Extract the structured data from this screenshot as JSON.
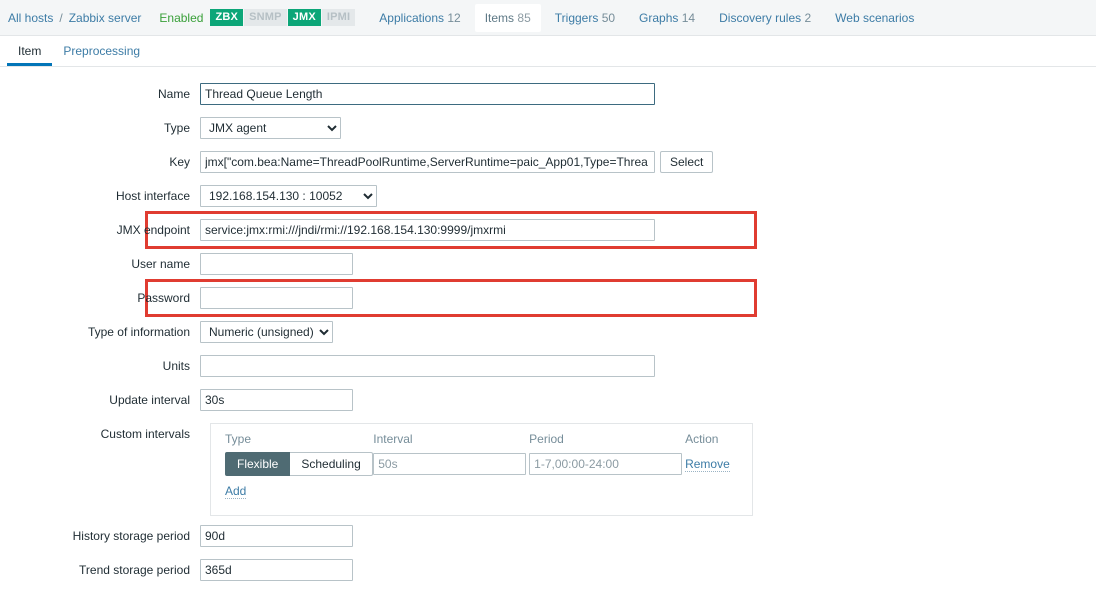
{
  "hostbar": {
    "all_hosts_link": "All hosts",
    "separator": "/",
    "host_name": "Zabbix server",
    "status": "Enabled",
    "badges": [
      {
        "label": "ZBX",
        "active": true
      },
      {
        "label": "SNMP",
        "active": false
      },
      {
        "label": "JMX",
        "active": true
      },
      {
        "label": "IPMI",
        "active": false
      }
    ],
    "tabs": [
      {
        "label": "Applications",
        "count": "12",
        "selected": false
      },
      {
        "label": "Items",
        "count": "85",
        "selected": true
      },
      {
        "label": "Triggers",
        "count": "50",
        "selected": false
      },
      {
        "label": "Graphs",
        "count": "14",
        "selected": false
      },
      {
        "label": "Discovery rules",
        "count": "2",
        "selected": false
      },
      {
        "label": "Web scenarios",
        "count": "",
        "selected": false
      }
    ]
  },
  "form_tabs": [
    {
      "label": "Item",
      "active": true
    },
    {
      "label": "Preprocessing",
      "active": false
    }
  ],
  "form": {
    "name": {
      "label": "Name",
      "value": "Thread Queue Length"
    },
    "type": {
      "label": "Type",
      "value": "JMX agent"
    },
    "key": {
      "label": "Key",
      "value": "jmx[\"com.bea:Name=ThreadPoolRuntime,ServerRuntime=paic_App01,Type=Threa",
      "select_button": "Select"
    },
    "host_interface": {
      "label": "Host interface",
      "value": "192.168.154.130 : 10052"
    },
    "jmx_endpoint": {
      "label": "JMX endpoint",
      "value": "service:jmx:rmi:///jndi/rmi://192.168.154.130:9999/jmxrmi"
    },
    "user_name": {
      "label": "User name",
      "value": ""
    },
    "password": {
      "label": "Password",
      "value": ""
    },
    "type_of_information": {
      "label": "Type of information",
      "value": "Numeric (unsigned)"
    },
    "units": {
      "label": "Units",
      "value": ""
    },
    "update_interval": {
      "label": "Update interval",
      "value": "30s"
    },
    "custom_intervals": {
      "label": "Custom intervals",
      "headers": [
        "Type",
        "Interval",
        "Period",
        "Action"
      ],
      "rows": [
        {
          "type_flexible": "Flexible",
          "type_scheduling": "Scheduling",
          "type_selected": "Flexible",
          "interval_placeholder": "50s",
          "interval_value": "",
          "period_placeholder": "1-7,00:00-24:00",
          "period_value": "",
          "action": "Remove"
        }
      ],
      "add_link": "Add"
    },
    "history_storage_period": {
      "label": "History storage period",
      "value": "90d"
    },
    "trend_storage_period": {
      "label": "Trend storage period",
      "value": "365d"
    }
  },
  "annotations": {
    "highlight_color": "#e03c31",
    "boxes": [
      "key-row",
      "jmx-endpoint-row"
    ]
  }
}
